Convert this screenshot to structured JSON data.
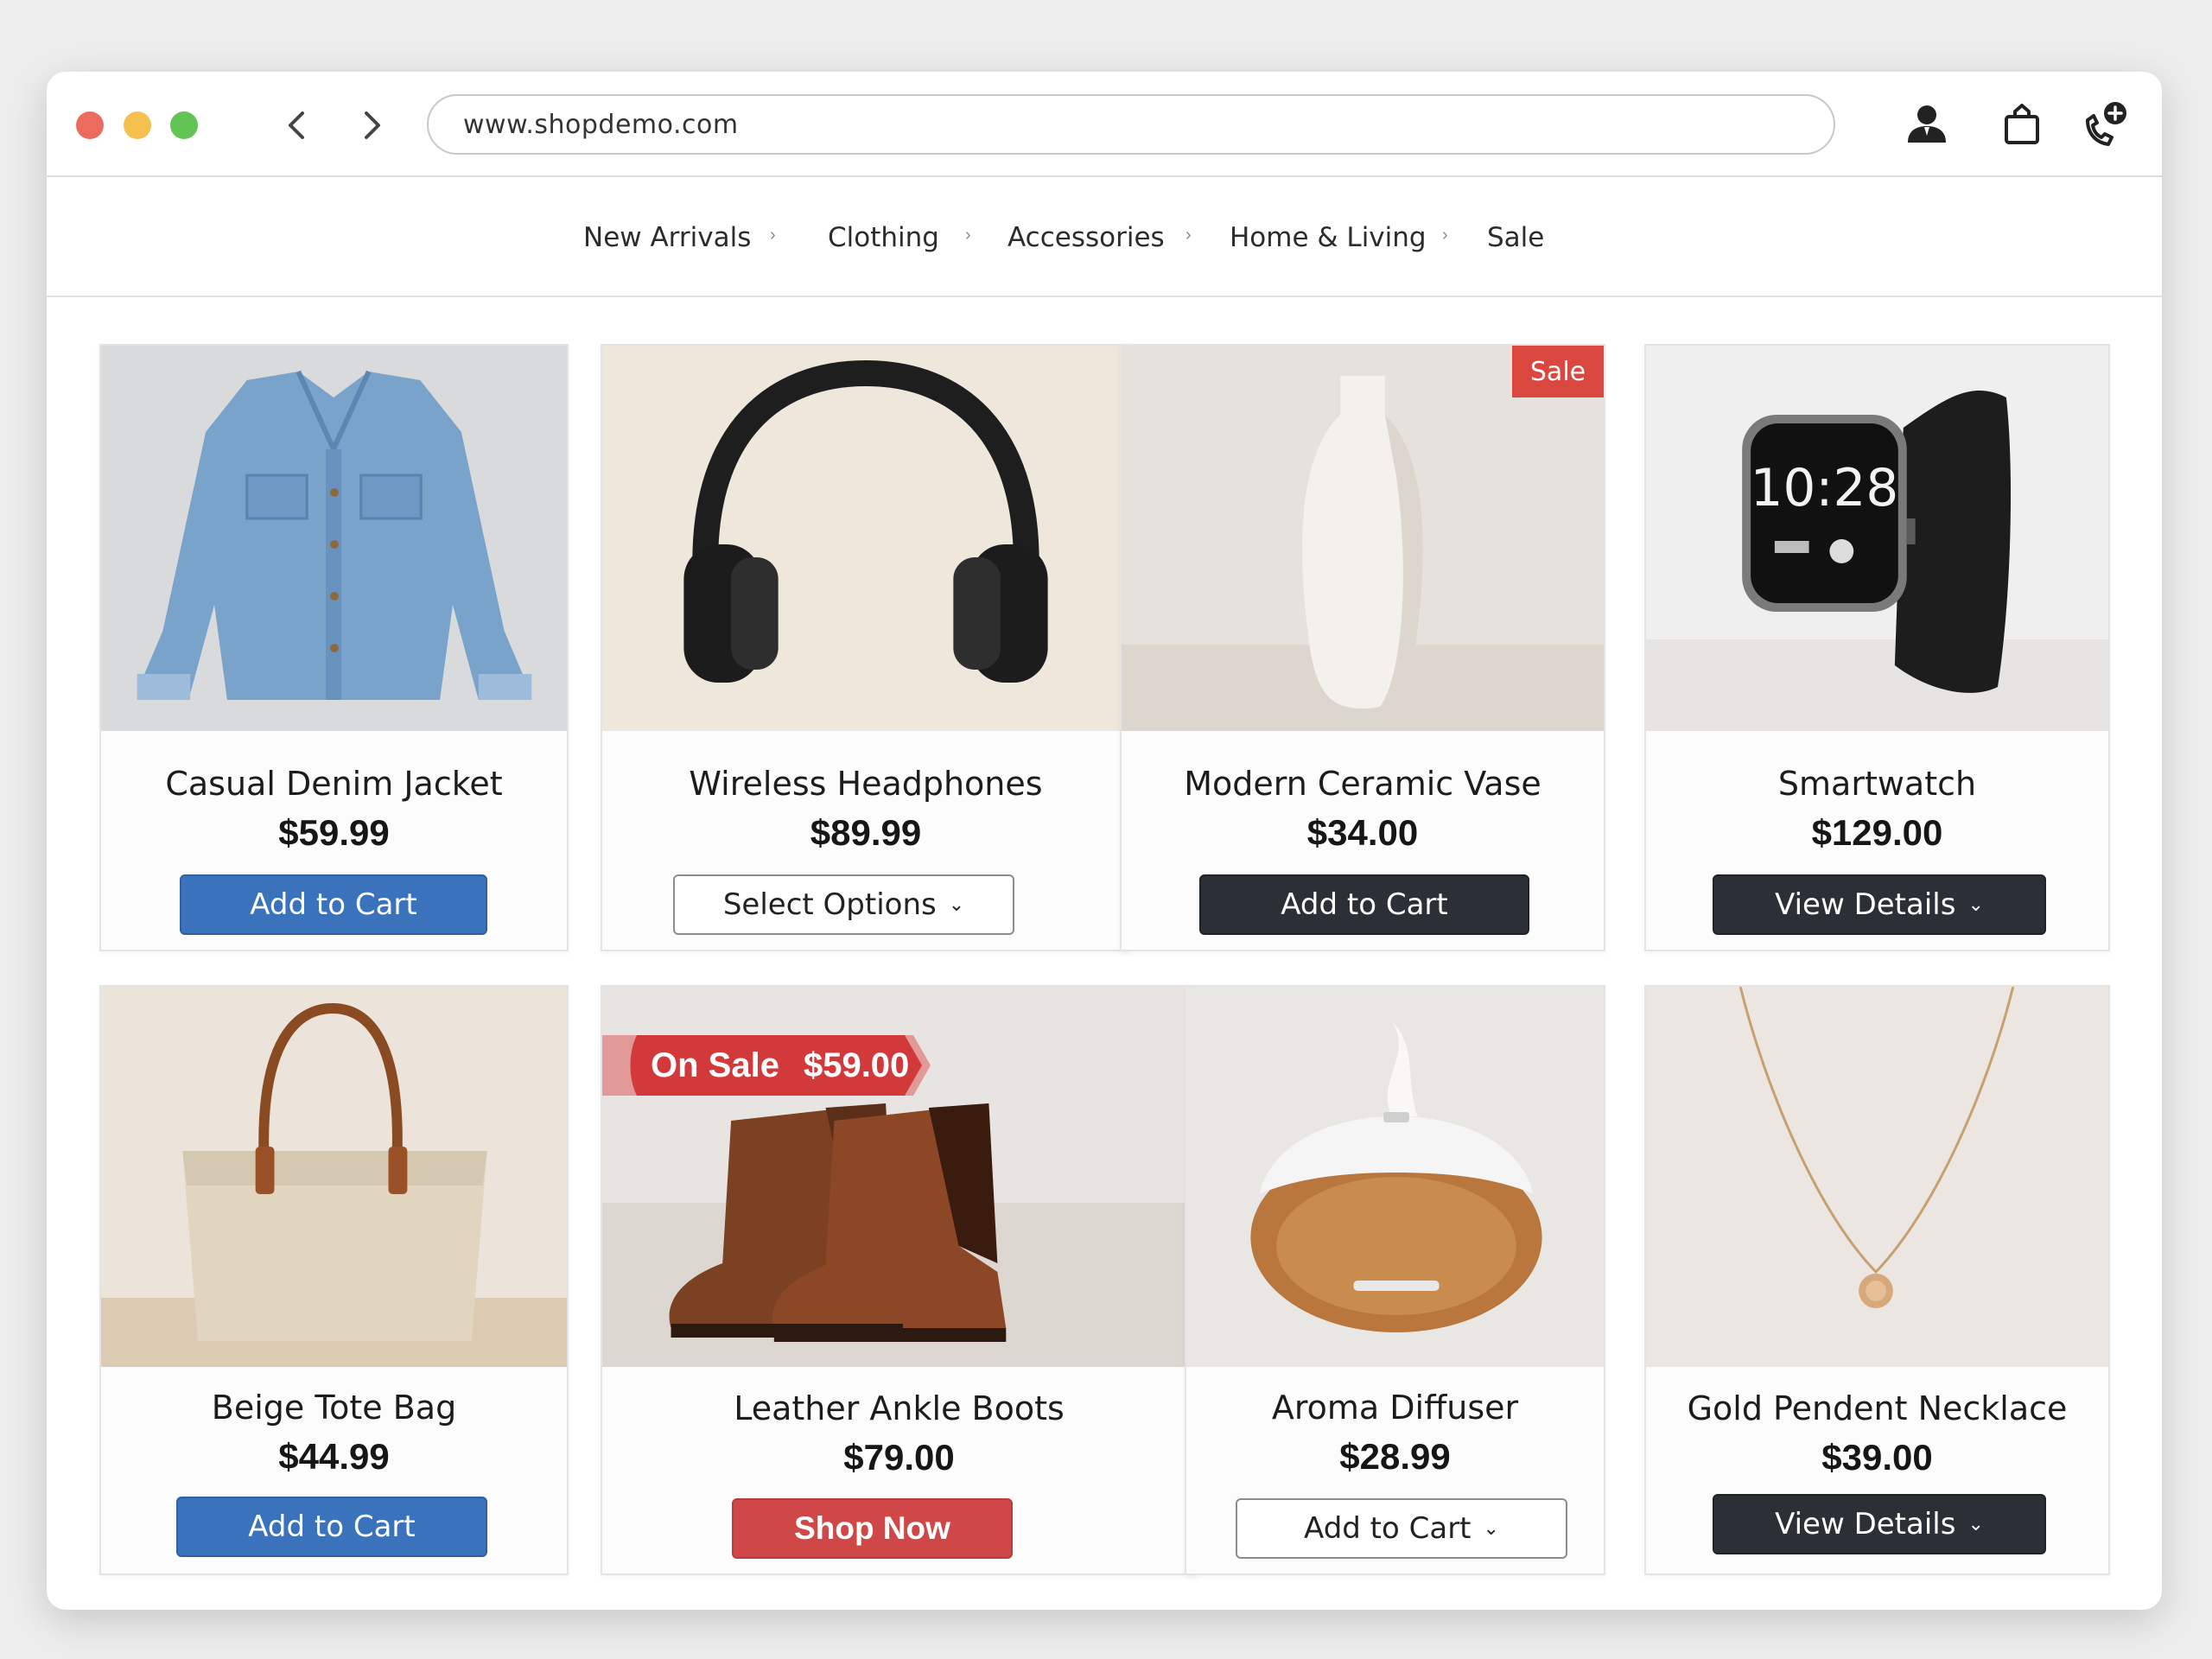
{
  "browser": {
    "url": "www.shopdemo.com",
    "traffic_lights": {
      "close": "#ed6a5e",
      "minimize": "#f5c04f",
      "maximize": "#61c454"
    },
    "icons": [
      "back-chevron-icon",
      "forward-chevron-icon",
      "user-icon",
      "shopping-bag-icon",
      "phone-add-icon"
    ]
  },
  "nav": {
    "items": [
      {
        "label": "New Arrivals"
      },
      {
        "label": "Clothing"
      },
      {
        "label": "Accessories"
      },
      {
        "label": "Home & Living"
      },
      {
        "label": "Sale"
      }
    ],
    "separator": "›"
  },
  "colors": {
    "primary_blue": "#3b72bc",
    "dark": "#2b2f36",
    "sale_red": "#cf4746"
  },
  "products": [
    {
      "name": "Casual Denim Jacket",
      "price": "$59.99",
      "button": "Add to Cart",
      "button_style": "blue",
      "image": "denim-jacket-photo"
    },
    {
      "name": "Wireless Headphones",
      "price": "$89.99",
      "button": "Select Options",
      "button_style": "outline-dropdown",
      "image": "headphones-photo"
    },
    {
      "name": "Modern Ceramic Vase",
      "price": "$34.00",
      "button": "Add to Cart",
      "button_style": "dark",
      "badge": "Sale",
      "image": "ceramic-vase-photo"
    },
    {
      "name": "Smartwatch",
      "price": "$129.00",
      "button": "View Details",
      "button_style": "dark-dropdown",
      "image": "smartwatch-photo",
      "watch_time": "10:28"
    },
    {
      "name": "Beige Tote Bag",
      "price": "$44.99",
      "button": "Add to Cart",
      "button_style": "blue",
      "image": "tote-bag-photo"
    },
    {
      "name": "Leather Ankle Boots",
      "price": "$79.00",
      "button": "Shop Now",
      "button_style": "red",
      "ribbon_label": "On Sale",
      "ribbon_price": "$59.00",
      "image": "ankle-boots-photo"
    },
    {
      "name": "Aroma Diffuser",
      "price": "$28.99",
      "button": "Add to Cart",
      "button_style": "outline-dropdown",
      "image": "aroma-diffuser-photo"
    },
    {
      "name": "Gold Pendent Necklace",
      "price": "$39.00",
      "button": "View Details",
      "button_style": "dark-dropdown",
      "image": "necklace-photo"
    }
  ]
}
